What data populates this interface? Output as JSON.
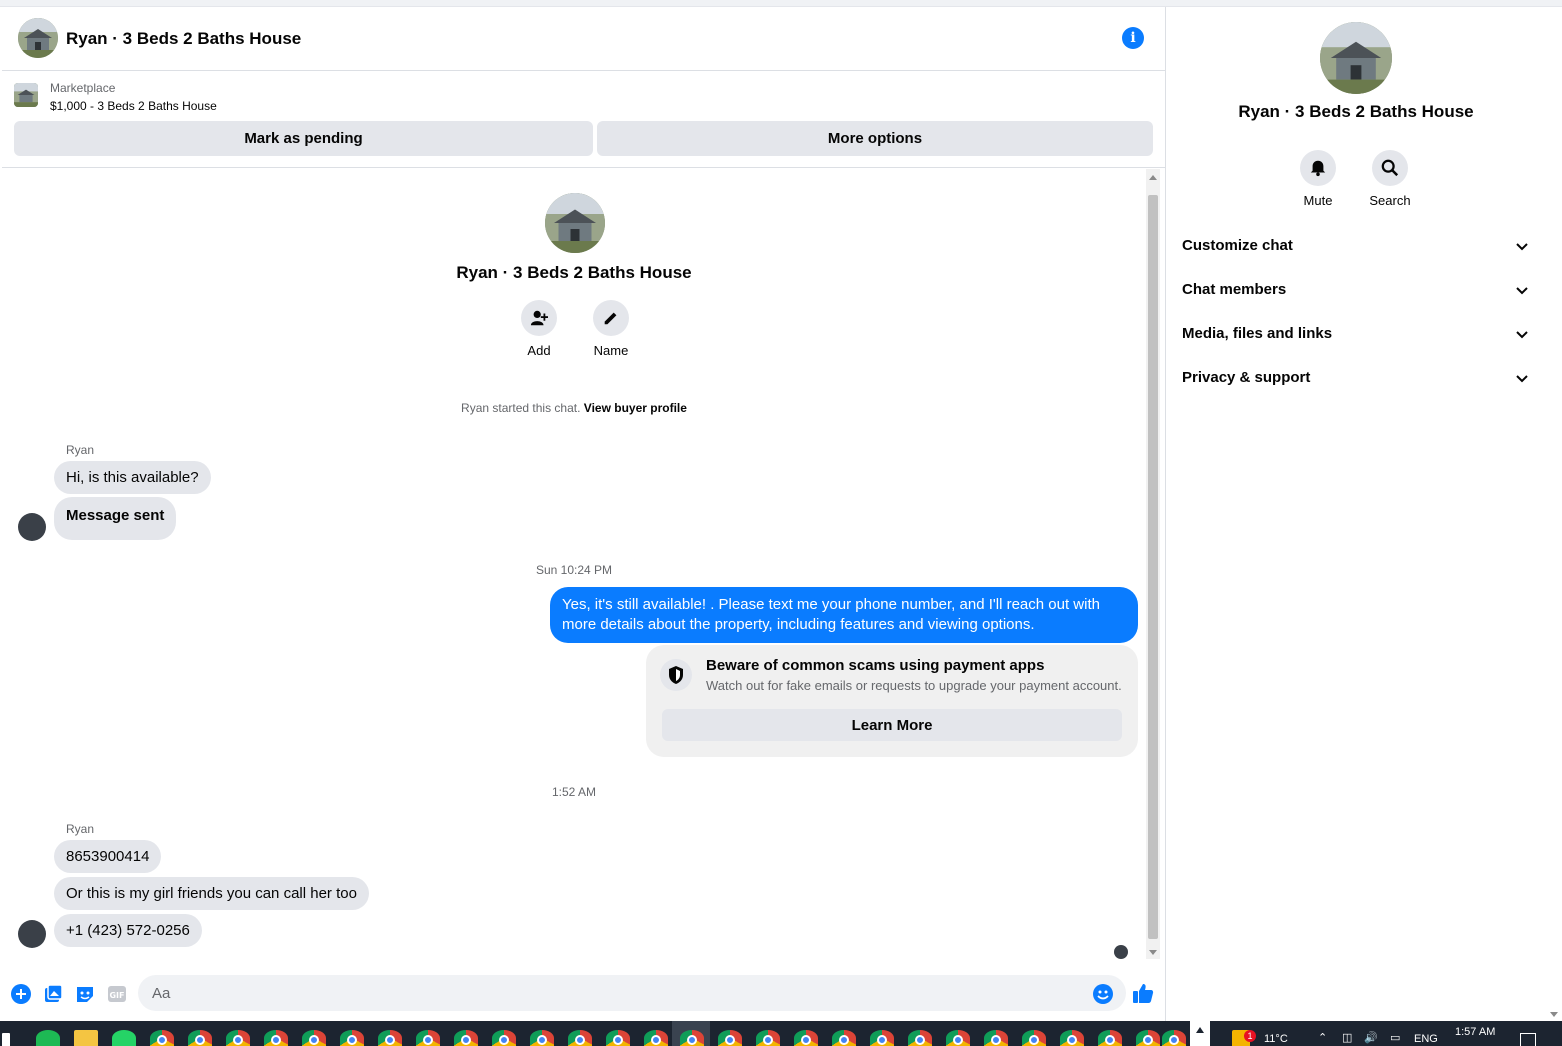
{
  "header": {
    "title": "Ryan · 3 Beds 2 Baths House",
    "info_icon": "info-icon"
  },
  "marketplace": {
    "label": "Marketplace",
    "listing": "$1,000 - 3 Beds 2 Baths House",
    "pending_label": "Mark as pending",
    "more_label": "More options"
  },
  "profile": {
    "title": "Ryan · 3 Beds 2 Baths House",
    "add_label": "Add",
    "name_label": "Name",
    "started_text": "Ryan started this chat.",
    "view_profile_label": "View buyer profile"
  },
  "messages": {
    "group1_sender": "Ryan",
    "msg1": "Hi, is this available?",
    "msg2": "Message sent",
    "time1": "Sun 10:24 PM",
    "out1": "Yes, it's still available! . Please text me your phone number, and I'll reach out with more details about the property, including features and viewing options.",
    "scam_title": "Beware of common scams using payment apps",
    "scam_sub": "Watch out for fake emails or requests to upgrade your payment account.",
    "learn_more": "Learn More",
    "time2": "1:52 AM",
    "group2_sender": "Ryan",
    "msg3": "8653900414",
    "msg4": "Or this is my girl friends you can call her too",
    "msg5": "+1 (423) 572-0256"
  },
  "composer": {
    "placeholder": "Aa"
  },
  "side": {
    "title": "Ryan · 3 Beds 2 Baths House",
    "mute_label": "Mute",
    "search_label": "Search",
    "rows": [
      "Customize chat",
      "Chat members",
      "Media, files and links",
      "Privacy & support"
    ]
  },
  "taskbar": {
    "temperature": "11°C",
    "language": "ENG",
    "time": "1:57 AM",
    "notification_count": "1"
  },
  "colors": {
    "accent": "#0a7cff",
    "bubble_in": "#e4e6eb",
    "taskbar": "#1c2430"
  }
}
